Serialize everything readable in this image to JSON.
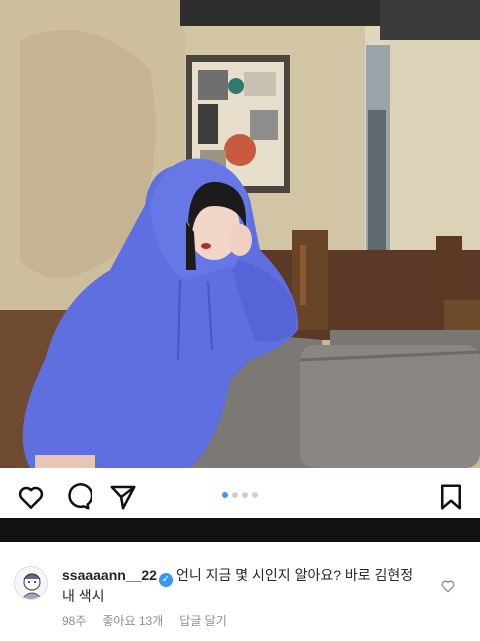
{
  "post": {
    "carousel": {
      "total": 4,
      "active_index": 0
    },
    "actions": {
      "like_icon": "heart-outline-icon",
      "comment_icon": "comment-bubble-icon",
      "share_icon": "paper-plane-icon",
      "save_icon": "bookmark-outline-icon"
    }
  },
  "comment": {
    "username": "ssaaaann__22",
    "verified": true,
    "text": "언니 지금 몇 시인지 알아요? 바로 김현정 내 색시",
    "time": "98주",
    "likes": "좋아요 13개",
    "reply_label": "답글 달기",
    "like_icon": "heart-outline-icon"
  },
  "colors": {
    "accent_blue": "#3897f0",
    "band": "#111111",
    "meta_gray": "#8e8e8e"
  }
}
